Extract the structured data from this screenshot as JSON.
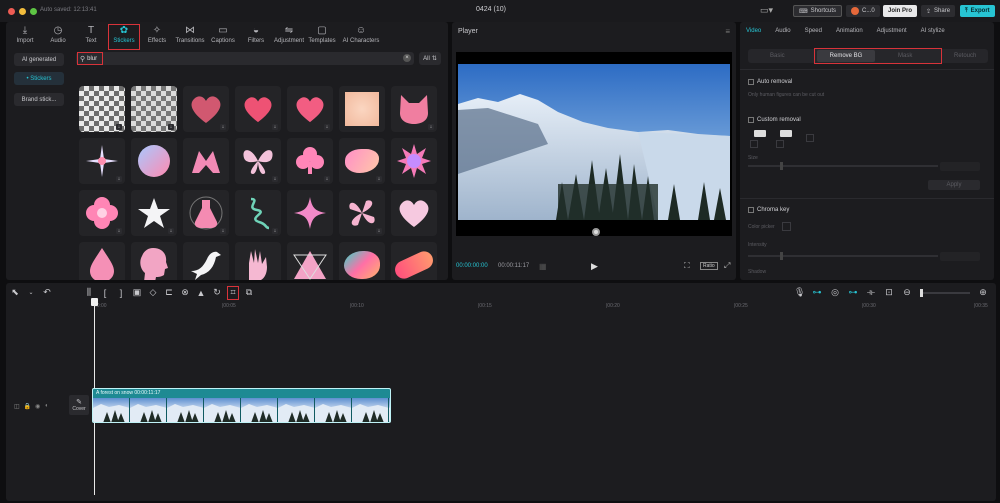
{
  "titlebar": {
    "autosave": "Auto saved: 12:13:41",
    "project_name": "0424 (10)",
    "shortcuts": "Shortcuts",
    "user": "C...0",
    "join_pro": "Join Pro",
    "share": "Share",
    "export": "Export"
  },
  "media_tabs": [
    {
      "label": "Import",
      "icon": "import-icon",
      "glyph": "⤓"
    },
    {
      "label": "Audio",
      "icon": "audio-icon",
      "glyph": "◷"
    },
    {
      "label": "Text",
      "icon": "text-icon",
      "glyph": "T"
    },
    {
      "label": "Stickers",
      "icon": "stickers-icon",
      "glyph": "✿"
    },
    {
      "label": "Effects",
      "icon": "effects-icon",
      "glyph": "✧"
    },
    {
      "label": "Transitions",
      "icon": "transitions-icon",
      "glyph": "⋈"
    },
    {
      "label": "Captions",
      "icon": "captions-icon",
      "glyph": "▭"
    },
    {
      "label": "Filters",
      "icon": "filters-icon",
      "glyph": "◒"
    },
    {
      "label": "Adjustment",
      "icon": "adjustment-icon",
      "glyph": "⇋"
    },
    {
      "label": "Templates",
      "icon": "templates-icon",
      "glyph": "▢"
    },
    {
      "label": "AI Characters",
      "icon": "ai-characters-icon",
      "glyph": "☺"
    }
  ],
  "sidebar": {
    "ai_generated": "AI generated",
    "stickers": "• Stickers",
    "brand_stick": "Brand stick..."
  },
  "search": {
    "value": "blur",
    "all_label": "All"
  },
  "player": {
    "title": "Player",
    "time_current": "00:00:00:00",
    "time_total": "00:00:11:17",
    "ratio": "Ratio"
  },
  "right_panel": {
    "tabs": [
      "Video",
      "Audio",
      "Speed",
      "Animation",
      "Adjustment",
      "AI stylize"
    ],
    "subtabs": [
      "Basic",
      "Remove BG",
      "Mask",
      "Retouch"
    ],
    "auto_removal": "Auto removal",
    "auto_removal_hint": "Only human figures can be cut out",
    "custom_removal": "Custom removal",
    "size_label": "Size",
    "apply": "Apply",
    "chroma_key": "Chroma key",
    "color_picker": "Color picker",
    "intensity": "Intensity",
    "shadow": "Shadow"
  },
  "timeline": {
    "ruler": [
      "00:00",
      "|00:05",
      "|00:10",
      "|00:15",
      "|00:20",
      "|00:25",
      "|00:30",
      "|00:35"
    ],
    "clip_title": "A forest on snow  00:00:11:17",
    "cover": "Cover"
  },
  "colors": {
    "accent": "#27c4d3",
    "highlight": "#d8333a",
    "clip": "#1e8a93"
  }
}
